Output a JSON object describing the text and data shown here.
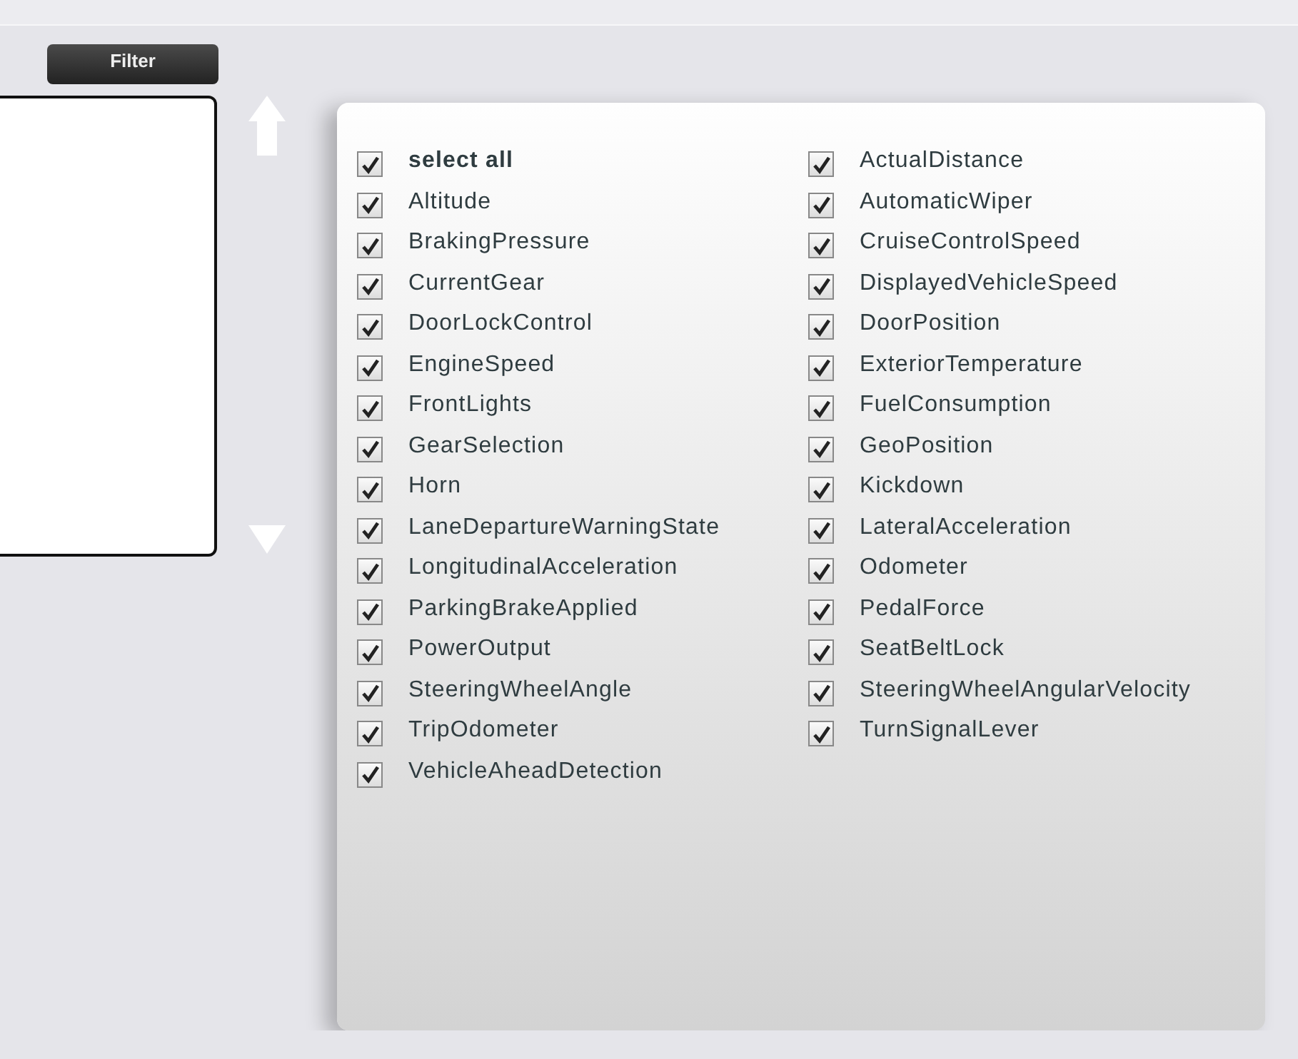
{
  "filter_button": {
    "label": "Filter"
  },
  "columns": [
    [
      {
        "label": "select all",
        "checked": true,
        "kind": "all"
      },
      {
        "label": "Altitude",
        "checked": true,
        "kind": "item"
      },
      {
        "label": "BrakingPressure",
        "checked": true,
        "kind": "item"
      },
      {
        "label": "CurrentGear",
        "checked": true,
        "kind": "item"
      },
      {
        "label": "DoorLockControl",
        "checked": true,
        "kind": "item"
      },
      {
        "label": "EngineSpeed",
        "checked": true,
        "kind": "item"
      },
      {
        "label": "FrontLights",
        "checked": true,
        "kind": "item"
      },
      {
        "label": "GearSelection",
        "checked": true,
        "kind": "item"
      },
      {
        "label": "Horn",
        "checked": true,
        "kind": "item"
      },
      {
        "label": "LaneDepartureWarningState",
        "checked": true,
        "kind": "item"
      },
      {
        "label": "LongitudinalAcceleration",
        "checked": true,
        "kind": "item"
      },
      {
        "label": "ParkingBrakeApplied",
        "checked": true,
        "kind": "item"
      },
      {
        "label": "PowerOutput",
        "checked": true,
        "kind": "item"
      },
      {
        "label": "SteeringWheelAngle",
        "checked": true,
        "kind": "item"
      },
      {
        "label": "TripOdometer",
        "checked": true,
        "kind": "item"
      },
      {
        "label": "VehicleAheadDetection",
        "checked": true,
        "kind": "item"
      }
    ],
    [
      {
        "label": "ActualDistance",
        "checked": true,
        "kind": "item"
      },
      {
        "label": "AutomaticWiper",
        "checked": true,
        "kind": "item"
      },
      {
        "label": "CruiseControlSpeed",
        "checked": true,
        "kind": "item"
      },
      {
        "label": "DisplayedVehicleSpeed",
        "checked": true,
        "kind": "item"
      },
      {
        "label": "DoorPosition",
        "checked": true,
        "kind": "item"
      },
      {
        "label": "ExteriorTemperature",
        "checked": true,
        "kind": "item"
      },
      {
        "label": "FuelConsumption",
        "checked": true,
        "kind": "item"
      },
      {
        "label": "GeoPosition",
        "checked": true,
        "kind": "item"
      },
      {
        "label": "Kickdown",
        "checked": true,
        "kind": "item"
      },
      {
        "label": "LateralAcceleration",
        "checked": true,
        "kind": "item"
      },
      {
        "label": "Odometer",
        "checked": true,
        "kind": "item"
      },
      {
        "label": "PedalForce",
        "checked": true,
        "kind": "item"
      },
      {
        "label": "SeatBeltLock",
        "checked": true,
        "kind": "item"
      },
      {
        "label": "SteeringWheelAngularVelocity",
        "checked": true,
        "kind": "item"
      },
      {
        "label": "TurnSignalLever",
        "checked": true,
        "kind": "item"
      }
    ]
  ]
}
